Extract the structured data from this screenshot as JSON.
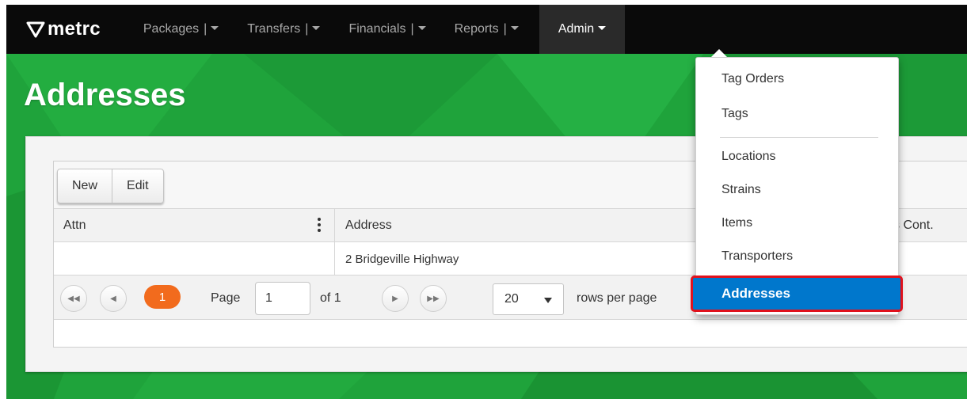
{
  "nav": {
    "brand": "metrc",
    "items": [
      {
        "label": "Packages"
      },
      {
        "label": "Transfers"
      },
      {
        "label": "Financials"
      },
      {
        "label": "Reports"
      }
    ],
    "separator": "|",
    "active": {
      "label": "Admin"
    }
  },
  "page": {
    "title": "Addresses"
  },
  "toolbar": {
    "new_label": "New",
    "edit_label": "Edit"
  },
  "grid": {
    "columns": [
      "Attn",
      "Address",
      "s Cont."
    ],
    "rows": [
      {
        "attn": "",
        "address": "2 Bridgeville Highway"
      }
    ]
  },
  "pager": {
    "current_page_badge": "1",
    "page_label": "Page",
    "page_input_value": "1",
    "of_label": "of 1",
    "rows_per_page_value": "20",
    "rows_per_page_label": "rows per page"
  },
  "admin_menu": {
    "items": [
      "Tag Orders",
      "Tags",
      "Locations",
      "Strains",
      "Items",
      "Transporters",
      "Addresses"
    ],
    "selected": "Addresses"
  },
  "colors": {
    "navbar": "#0a0a0a",
    "green_bg": "#1fa33b",
    "pager_current": "#f26b1d",
    "menu_selected": "#0077cc",
    "highlight_border": "#e0121d"
  },
  "icons": [
    "metrc-logo-icon",
    "caret-down-icon",
    "kebab-menu-icon",
    "first-page-icon",
    "prev-page-icon",
    "next-page-icon",
    "last-page-icon",
    "select-arrow-icon"
  ]
}
